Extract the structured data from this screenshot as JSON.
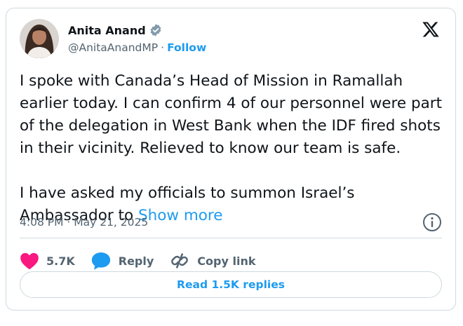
{
  "author": {
    "name": "Anita Anand",
    "handle": "@AnitaAnandMP",
    "separator": "·",
    "follow_label": "Follow"
  },
  "tweet": {
    "paragraph_1": "I spoke with Canada’s Head of Mission in Ramallah earlier today. I can confirm 4 of our personnel were part of the delegation in West Bank when the IDF fired shots in their vicinity. Relieved to know our team is safe.",
    "paragraph_2": "I have asked my officials to summon Israel’s Ambassador to",
    "show_more": "Show more"
  },
  "timestamp": "4:08 PM · May 21, 2025",
  "actions": {
    "likes": "5.7K",
    "reply_label": "Reply",
    "copy_link_label": "Copy link"
  },
  "read_replies_label": "Read 1.5K replies",
  "colors": {
    "accent": "#1d9bf0",
    "like": "#f91880",
    "text": "#0f1419",
    "secondary": "#536471",
    "border": "#cfd9de"
  }
}
